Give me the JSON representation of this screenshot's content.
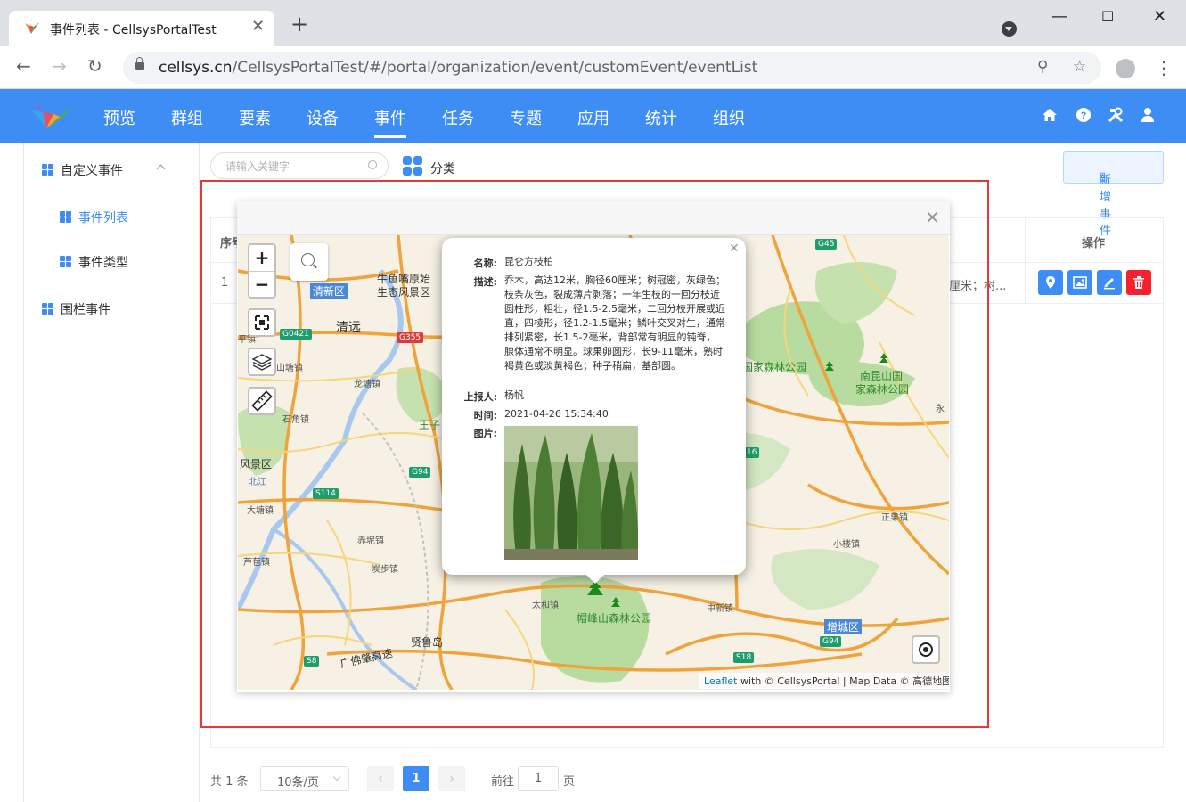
{
  "browser": {
    "tab_title": "事件列表 - CellsysPortalTest",
    "url_host": "cellsys.cn",
    "url_path": "/CellsysPortalTest/#/portal/organization/event/customEvent/eventList"
  },
  "nav": {
    "items": [
      "预览",
      "群组",
      "要素",
      "设备",
      "事件",
      "任务",
      "专题",
      "应用",
      "统计",
      "组织"
    ],
    "active": "事件"
  },
  "sidebar": {
    "group1": "自定义事件",
    "sub1": "事件列表",
    "sub2": "事件类型",
    "group2": "围栏事件"
  },
  "toolbar": {
    "search_placeholder": "请输入关键字",
    "category_label": "分类",
    "add_button": "新增事件"
  },
  "table": {
    "col_index": "序号",
    "col_ops": "操作",
    "rows": [
      {
        "index": "1",
        "desc_tail": "厘米；树..."
      }
    ]
  },
  "pagination": {
    "total": "共 1 条",
    "page_size": "10条/页",
    "current": "1",
    "goto_label": "前往",
    "goto_value": "1",
    "page_unit": "页"
  },
  "map": {
    "attribution_link": "Leaflet",
    "attribution_rest": " with © CellsysPortal | Map Data © 高德地图",
    "zoom_in": "+",
    "zoom_out": "−",
    "labels": {
      "niuyuzui": "牛鱼嘴原始",
      "niuyuzui2": "生态风景区",
      "qingxin": "清新区",
      "qingyuan": "清远",
      "pingyuan": "平镇",
      "shantang": "山塘镇",
      "longtang": "龙塘镇",
      "shijiao": "石角镇",
      "wangzi": "王子",
      "fengjingqu": "风景区",
      "beijiang": "北江",
      "datang": "大塘镇",
      "chini": "赤坭镇",
      "lutang": "芦苞镇",
      "tanbu": "炭步镇",
      "taihe": "太和镇",
      "maofeng": "帽峰山森林公园",
      "zhongxin": "中新镇",
      "zengcheng": "增城区",
      "zhengguo": "正果镇",
      "xiaolou": "小楼镇",
      "nankunshan": "南昆山国",
      "nankunshan2": "家森林公园",
      "forest_park": "国家森林公园",
      "xianlu": "贤鲁岛",
      "guangfo": "广佛肇高速",
      "yong": "永"
    },
    "shields": {
      "g0421": "G0421",
      "g355": "G355",
      "g94a": "G94",
      "s114": "S114",
      "s8": "S8",
      "s18": "S18",
      "g94b": "G94",
      "g45": "G45",
      "s16": "16"
    }
  },
  "popup": {
    "name_key": "名称:",
    "name": "昆仑方枝柏",
    "desc_key": "描述:",
    "desc": "乔木，高达12米，胸径60厘米；树冠密，灰绿色；枝条灰色，裂成薄片剥落；一年生枝的一回分枝近圆柱形，粗壮，径1.5-2.5毫米，二回分枝开展或近直，四棱形，径1.2-1.5毫米；鳞叶交叉对生，通常排列紧密，长1.5-2毫米，背部常有明显的钝脊，腺体通常不明显。球果卵圆形，长9-11毫米，熟时褐黄色或淡黄褐色；种子稍扁，基部圆。",
    "reporter_key": "上报人:",
    "reporter": "杨帆",
    "time_key": "时间:",
    "time": "2021-04-26 15:34:40",
    "image_key": "图片:"
  },
  "colors": {
    "primary": "#3e8df4",
    "danger": "#f5222d",
    "highlight_box": "#e53935"
  }
}
